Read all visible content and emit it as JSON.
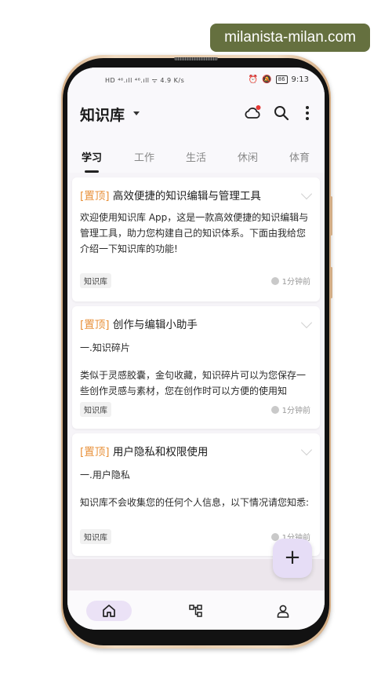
{
  "watermark": "milanista-milan.com",
  "status_bar": {
    "left_indicators": "HD ⁴⁶.ıll ⁴⁶.ıll ᯤ 4.9 K/s",
    "battery": "86",
    "time": "9:13"
  },
  "app_bar": {
    "title": "知识库",
    "icons": [
      "cloud-sync-icon",
      "search-icon",
      "more-vert-icon"
    ],
    "sync_badge_color": "#e53935"
  },
  "tabs": [
    {
      "label": "学习",
      "active": true
    },
    {
      "label": "工作",
      "active": false
    },
    {
      "label": "生活",
      "active": false
    },
    {
      "label": "休闲",
      "active": false
    },
    {
      "label": "体育",
      "active": false
    }
  ],
  "cards": [
    {
      "pin_label": "[置顶]",
      "title": "高效便捷的知识编辑与管理工具",
      "body": "欢迎使用知识库 App，这是一款高效便捷的知识编辑与管理工具，助力您构建自己的知识体系。下面由我给您介绍一下知识库的功能!",
      "tag": "知识库",
      "time": "1分钟前"
    },
    {
      "pin_label": "[置顶]",
      "title": "创作与编辑小助手",
      "subheading": "一.知识碎片",
      "body": "类似于灵感胶囊，金句收藏，知识碎片可以为您保存一些创作灵感与素材，您在创作时可以方便的使用知",
      "tag": "知识库",
      "time": "1分钟前"
    },
    {
      "pin_label": "[置顶]",
      "title": "用户隐私和权限使用",
      "subheading": "一.用户隐私",
      "body": "知识库不会收集您的任何个人信息，以下情况请您知悉:",
      "tag": "知识库",
      "time": "1分钟前"
    }
  ],
  "fab": {
    "label": "+"
  },
  "bottom_nav": [
    "home-icon",
    "structure-icon",
    "profile-icon"
  ],
  "colors": {
    "accent": "#e8923c",
    "pill": "#ebe2f6"
  }
}
